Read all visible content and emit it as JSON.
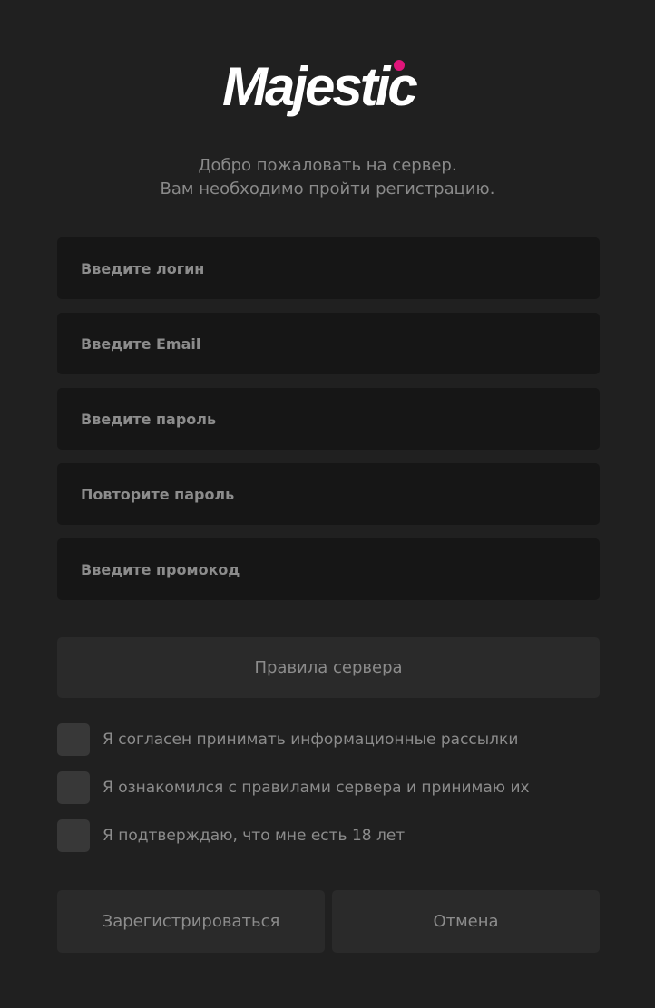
{
  "logo": {
    "text": "Majestic",
    "accent_color": "#e0157a",
    "text_color": "#ffffff"
  },
  "welcome": {
    "line1": "Добро пожаловать на сервер.",
    "line2": "Вам необходимо пройти регистрацию."
  },
  "fields": {
    "login": {
      "placeholder": "Введите логин",
      "value": ""
    },
    "email": {
      "placeholder": "Введите Email",
      "value": ""
    },
    "password": {
      "placeholder": "Введите пароль",
      "value": ""
    },
    "password_repeat": {
      "placeholder": "Повторите пароль",
      "value": ""
    },
    "promo": {
      "placeholder": "Введите промокод",
      "value": ""
    }
  },
  "rules_button": {
    "label": "Правила сервера"
  },
  "checkboxes": [
    {
      "label": "Я согласен принимать информационные рассылки",
      "checked": false
    },
    {
      "label": "Я ознакомился с правилами сервера и принимаю их",
      "checked": false
    },
    {
      "label": "Я подтверждаю, что мне есть 18 лет",
      "checked": false
    }
  ],
  "actions": {
    "register_label": "Зарегистрироваться",
    "cancel_label": "Отмена"
  },
  "colors": {
    "background": "#202020",
    "field_bg": "#161616",
    "button_bg": "#2a2a2a",
    "checkbox_bg": "#383838",
    "text_muted": "#8c8c8c"
  }
}
